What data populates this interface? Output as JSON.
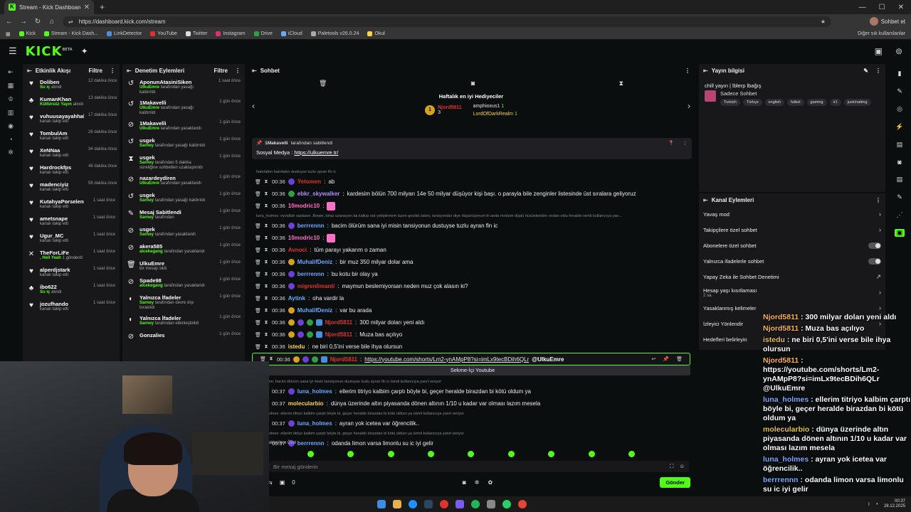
{
  "browser": {
    "tab_title": "Stream - Kick Dashboard",
    "url": "https://dashboard.kick.com/stream",
    "profile_label": "Sohbet et",
    "bookmarks": [
      "Kick",
      "Stream - Kick Dash...",
      "LinkDetector",
      "YouTube",
      "Twitter",
      "Instagram",
      "Drive",
      "iCloud",
      "Paletools v26.0.24",
      "Okul"
    ],
    "bookmarks_right": "Diğer sık kullanılanlar"
  },
  "kick": {
    "logo": "KICK",
    "logo_sup": "BETA"
  },
  "activity": {
    "title": "Etkinlik Akışı",
    "filter": "Filtre",
    "items": [
      {
        "icon": "♥",
        "name": "Doliben",
        "desc": "Su iç",
        "desc2": "alındı",
        "time": "12 dakika önce"
      },
      {
        "icon": "♣",
        "name": "KumanKhan",
        "desc": "Kültürsüz Yayın",
        "desc2": "alındı",
        "time": "13 dakika önce"
      },
      {
        "icon": "♥",
        "name": "vuhuusayayahhahs",
        "desc": "",
        "desc2": "kanalı takip etti",
        "time": "17 dakika önce"
      },
      {
        "icon": "♥",
        "name": "TombulAm",
        "desc": "",
        "desc2": "kanalı takip etti",
        "time": "26 dakika önce"
      },
      {
        "icon": "♥",
        "name": "XeNNaa",
        "desc": "",
        "desc2": "kanalı takip etti",
        "time": "34 dakika önce"
      },
      {
        "icon": "♥",
        "name": "Hardrockfps",
        "desc": "",
        "desc2": "kanalı takip etti",
        "time": "46 dakika önce"
      },
      {
        "icon": "♥",
        "name": "madenciyiz",
        "desc": "",
        "desc2": "kanalı takip etti",
        "time": "58 dakika önce"
      },
      {
        "icon": "♥",
        "name": "KutahyaPorselennn",
        "desc": "",
        "desc2": "kanalı takip etti",
        "time": "1 saat önce"
      },
      {
        "icon": "♥",
        "name": "ametsnape",
        "desc": "",
        "desc2": "kanalı takip etti",
        "time": "1 saat önce"
      },
      {
        "icon": "♥",
        "name": "Ugur_MC",
        "desc": "",
        "desc2": "kanalı takip etti",
        "time": "1 saat önce"
      },
      {
        "icon": "✕",
        "name": "TheForLiFe",
        "desc": ", Hell Yeah",
        "desc2": "1 gönderdi",
        "time": "1 saat önce"
      },
      {
        "icon": "♥",
        "name": "alperdjstark",
        "desc": "",
        "desc2": "kanalı takip etti",
        "time": "1 saat önce"
      },
      {
        "icon": "♣",
        "name": "ibo622",
        "desc": "Su iç",
        "desc2": "alındı",
        "time": "1 saat önce"
      },
      {
        "icon": "♥",
        "name": "jozufhando",
        "desc": "",
        "desc2": "kanalı takip etti",
        "time": "1 saat önce"
      }
    ]
  },
  "actions": {
    "title": "Denetim Eylemleri",
    "filter": "Filtre",
    "items": [
      {
        "icon": "↺",
        "name": "AponunAtasiniSiken",
        "by": "UlkuEmre",
        "desc": "tarafından yasağı kaldırıldı",
        "time": "1 saat önce"
      },
      {
        "icon": "↺",
        "name": "1Makavelli",
        "by": "UlkuEmre",
        "desc": "tarafından yasağı kaldırıldı",
        "time": "1 gün önce"
      },
      {
        "icon": "⊘",
        "name": "1Makavelli",
        "by": "UlkuEmre",
        "desc": "tarafından yasaklandı",
        "time": "1 gün önce"
      },
      {
        "icon": "↺",
        "name": "usgek",
        "by": "Sarney",
        "desc": "tarafından yasağı kaldırıldı",
        "time": "1 gün önce"
      },
      {
        "icon": "⧗",
        "name": "usgek",
        "by": "Sarney",
        "desc": "tarafından 5 dakika süreliğine sohbetten uzaklaştırıldı",
        "time": "1 gün önce"
      },
      {
        "icon": "⊘",
        "name": "nazardeydiren",
        "by": "UlkuEmre",
        "desc": "tarafından yasaklandı",
        "time": "1 gün önce"
      },
      {
        "icon": "↺",
        "name": "usgek",
        "by": "Sarney",
        "desc": "tarafından yasağı kaldırıldı",
        "time": "1 gün önce"
      },
      {
        "icon": "✎",
        "name": "Mesaj Sabitlendi",
        "by": "Sarney",
        "desc": "tarafından",
        "time": "1 gün önce"
      },
      {
        "icon": "⊘",
        "name": "usgek",
        "by": "Sarney",
        "desc": "tarafından yasaklandı",
        "time": "1 gün önce"
      },
      {
        "icon": "⊘",
        "name": "akera585",
        "by": "alcekegang",
        "desc": "tarafından yasaklandı",
        "time": "1 gün önce"
      },
      {
        "icon": "🗑",
        "name": "UlkuEmre",
        "by": "",
        "desc": "bir mesajı sildi",
        "time": "1 gün önce"
      },
      {
        "icon": "⊘",
        "name": "Spade98",
        "by": "alcekegang",
        "desc": "tarafından yasaklandı",
        "time": "1 gün önce"
      },
      {
        "icon": "◐",
        "name": "Yalnızca İfadeler",
        "by": "Sarney",
        "desc": "tarafından devre dışı bırakıldı",
        "time": "1 gün önce"
      },
      {
        "icon": "◐",
        "name": "Yalnızca İfadeler",
        "by": "Sarney",
        "desc": "tarafından etkinleştirildi",
        "time": "1 gün önce"
      },
      {
        "icon": "⊘",
        "name": "Gonzalies",
        "by": "",
        "desc": "",
        "time": "1 gün önce"
      }
    ]
  },
  "chat": {
    "title": "Sohbet",
    "gifts_title": "Haftalık en iyi Hediyeciler",
    "gifts": {
      "first": {
        "name": "Njord5811",
        "count": "3"
      },
      "others": [
        {
          "name": "amphioxus1",
          "count": "1"
        },
        {
          "name": "LordOfDarkRealm",
          "count": "1"
        }
      ]
    },
    "pinned": {
      "by": "1Makavelli",
      "label": "tarafından sabitlendi",
      "prefix": "Sosyal Medya :",
      "link": "https://ulkuemre.tr/"
    },
    "messages": [
      {
        "type": "sm",
        "text": "hatırlattın hatırlattın dustuyse tuzlu ayran fln ic"
      },
      {
        "type": "m",
        "time": "00:36",
        "user": "Yetomen",
        "color": "#e0312b",
        "text": "ab"
      },
      {
        "type": "m",
        "time": "00:36",
        "user": "ebkr_skywalker",
        "color": "#b58cff",
        "text": "kardesim bölün 700 milyarı 14e 50 milyar düşüyor kişi başı. o parayla bile zenginler listesinde üst sıralara geliyoruz"
      },
      {
        "type": "m",
        "time": "00:36",
        "user": "10modric10",
        "color": "#ff6ec7",
        "text": ""
      },
      {
        "type": "sm",
        "text": "luna_holmes: eyvallah saolasın ,Bowie, biraz uzanayım da kalkıp not yetiştirmem lazım gecikti zaten, tansiyondur diye düşünüyorum bi anda modum düştü hüzünlendim ondan oldu heralde isimli kullanıcıya yan..."
      },
      {
        "type": "m",
        "time": "00:36",
        "user": "berrrennn",
        "color": "#6aa8ff",
        "text": "bacim ölürüm sana iyi misin tansiyonun dustuyse tuzlu ayran fln ic"
      },
      {
        "type": "m",
        "time": "00:36",
        "user": "10modric10",
        "color": "#ff6ec7",
        "text": ""
      },
      {
        "type": "m",
        "time": "00:36",
        "user": "Avnoci",
        "color": "#e0312b",
        "text": "tüm parayı yakarım o zaman"
      },
      {
        "type": "m",
        "time": "00:36",
        "user": "MuhalifDeniz",
        "color": "#6aa8ff",
        "text": "bir muz 350 milyar dolar ama"
      },
      {
        "type": "m",
        "time": "00:36",
        "user": "berrrennn",
        "color": "#6aa8ff",
        "text": "bu kotu bir olay ya"
      },
      {
        "type": "m",
        "time": "00:36",
        "user": "migrenlimanti",
        "color": "#e0312b",
        "text": "maymun beslemiyorsan neden muz çok alasın ki?"
      },
      {
        "type": "m",
        "time": "00:36",
        "user": "Aytink",
        "color": "#6aa8ff",
        "text": "oha vardir la"
      },
      {
        "type": "m",
        "time": "00:36",
        "user": "MuhalifDeniz",
        "color": "#6aa8ff",
        "text": "var bu arada"
      },
      {
        "type": "m",
        "time": "00:36",
        "user": "Njord5811",
        "color": "#e0312b",
        "text": "300 milyar doları yeni aldı"
      },
      {
        "type": "m",
        "time": "00:36",
        "user": "Njord5811",
        "color": "#e0312b",
        "text": "Muza bas açılıyo"
      },
      {
        "type": "m",
        "time": "00:36",
        "user": "istedu",
        "color": "#ffd24a",
        "text": "ne biri 0,5'ini verse bile ihya olursun"
      },
      {
        "type": "hl",
        "time": "00:36",
        "user": "Njord5811",
        "color": "#e0312b",
        "link": "https://youtube.com/shorts/Lm2-ynAMpP8?si=imLx9tecBDih6QLr",
        "mention": "@UlkuEmre"
      },
      {
        "type": "yt",
        "text": "Sekme-İçi Youtube"
      },
      {
        "type": "sm",
        "text": "berrrennn: bacim ölürüm sana iyi misin tansiyonun dustuyse tuzlu ayran fln ic isimli kullanıcıya yanıt veriyor"
      },
      {
        "type": "m",
        "time": "00:37",
        "user": "luna_holmes",
        "color": "#6aa8ff",
        "text": "ellerim titriyo kalbim çarptı böyle bi, geçer heralde birazdan bi kötü oldum ya"
      },
      {
        "type": "m",
        "time": "00:37",
        "user": "molecularbio",
        "color": "#ffd24a",
        "text": "dünya üzerinde altın piyasanda dönen altının 1/10 u kadar var olması lazım mesela"
      },
      {
        "type": "sm",
        "text": "luna_holmes: ellerim titriyo kalbim çarptı böyle bi, geçer heralde birazdan bi kötü oldum ya isimli kullanıcıya yanıt veriyor"
      },
      {
        "type": "m",
        "time": "00:37",
        "user": "luna_holmes",
        "color": "#6aa8ff",
        "text": "ayran yok icetea var öğrencilik.."
      },
      {
        "type": "sm",
        "text": "luna_holmes: ellerim titriyo kalbim çarptı böyle bi, geçer heralde birazdan bi kötü oldum ya isimli kullanıcıya yanıt veriyor"
      },
      {
        "type": "m",
        "time": "00:37",
        "user": "berrrennn",
        "color": "#6aa8ff",
        "text": "odanda limon varsa limonlu su ic iyi gelir"
      }
    ],
    "subs_only": "Takipçilere Özel",
    "input_placeholder": "Bir mesaj gönderin",
    "count": "0",
    "send": "Gönder"
  },
  "stream_info": {
    "title": "Yayın bilgisi",
    "stream_title": "chill yayın | lblerp lbağış",
    "category": "Sadece Sohbet",
    "tags": [
      "Turkish",
      "Türkçe",
      "english",
      "futbol",
      "gaming",
      "ir1",
      "justchatting"
    ]
  },
  "channel_actions": {
    "title": "Kanal Eylemleri",
    "items": [
      {
        "label": "Yavaş mod",
        "kind": "arrow"
      },
      {
        "label": "Takipçilere özel sohbet",
        "kind": "arrow"
      },
      {
        "label": "Abonelere özel sohbet",
        "kind": "toggle"
      },
      {
        "label": "Yalnızca ifadelerle sohbet",
        "kind": "toggle"
      },
      {
        "label": "Yapay Zeka ile Sohbet Denetimi",
        "kind": "link"
      },
      {
        "label": "Hesap yaşı kısıtlaması",
        "sub": "2 sa.",
        "kind": "arrow"
      },
      {
        "label": "Yasaklanmış kelimeler",
        "kind": "arrow"
      },
      {
        "label": "İzleyici Yönlendir",
        "kind": "arrow"
      },
      {
        "label": "Hedefleri belirleyin",
        "kind": "arrow"
      }
    ]
  },
  "overlay": [
    {
      "name": "Njord5811",
      "text": " : 300 milyar doları yeni aldı"
    },
    {
      "name": "Njord5811",
      "text": " : Muza bas açılıyo"
    },
    {
      "name": "istedu",
      "text": " : ne biri 0,5'ini verse bile ihya olursun"
    },
    {
      "name": "Njord5811",
      "text": " : https://youtube.com/shorts/Lm2-ynAMpP8?si=imLx9tecBDih6QLr @UlkuEmre"
    },
    {
      "name": "luna_holmes",
      "text": " : ellerim titriyo kalbim çarptı böyle bi, geçer heralde birazdan bi kötü oldum ya"
    },
    {
      "name": "molecularbio",
      "text": " : dünya üzerinde altın piyasanda dönen altının 1/10 u kadar var olması lazım mesela"
    },
    {
      "name": "luna_holmes",
      "text": " : ayran yok icetea var öğrencilik.."
    },
    {
      "name": "berrrennn",
      "text": " : odanda limon varsa limonlu su ic iyi gelir"
    }
  ],
  "taskbar": {
    "time": "00:37",
    "date": "28.12.2025"
  },
  "colors": {
    "accent": "#53fc18",
    "panel": "#18181b",
    "bg": "#0b0e0f"
  }
}
